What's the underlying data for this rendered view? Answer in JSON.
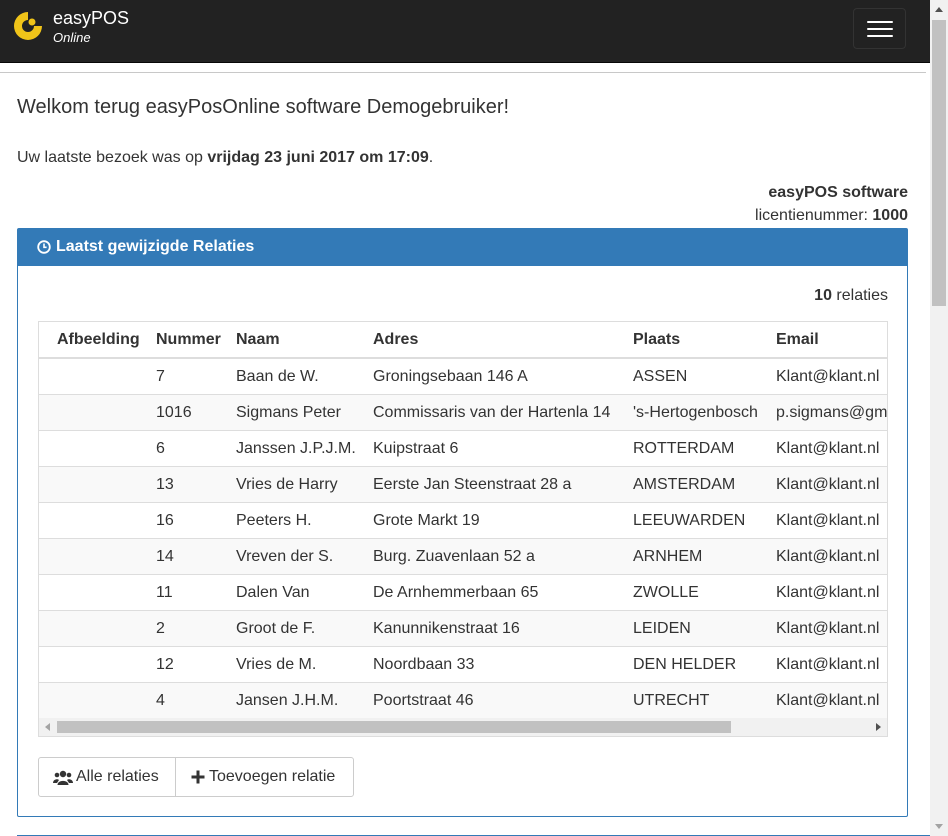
{
  "navbar": {
    "brand_name": "easyPOS",
    "brand_sub": "Online",
    "logo_color": "#f0c419"
  },
  "page": {
    "welcome": "Welkom terug easyPosOnline software Demogebruiker!",
    "last_visit_prefix": "Uw laatste bezoek was op ",
    "last_visit_date": "vrijdag 23 juni 2017 om 17:09",
    "last_visit_suffix": ".",
    "company": "easyPOS software",
    "license_label": "licentienummer: ",
    "license_number": "1000"
  },
  "panel": {
    "title": "Laatst gewijzigde Relaties",
    "count_value": "10",
    "count_label": " relaties",
    "accent": "#337ab7",
    "columns": [
      "Afbeelding",
      "Nummer",
      "Naam",
      "Adres",
      "Plaats",
      "Email"
    ],
    "rows": [
      {
        "img": "",
        "nummer": "7",
        "naam": "Baan de W.",
        "adres": "Groningsebaan 146 A",
        "plaats": "ASSEN",
        "email": "Klant@klant.nl"
      },
      {
        "img": "",
        "nummer": "1016",
        "naam": "Sigmans Peter",
        "adres": "Commissaris van der Hartenla 14",
        "plaats": "'s-Hertogenbosch",
        "email": "p.sigmans@gm"
      },
      {
        "img": "",
        "nummer": "6",
        "naam": "Janssen J.P.J.M.",
        "adres": "Kuipstraat 6",
        "plaats": "ROTTERDAM",
        "email": "Klant@klant.nl"
      },
      {
        "img": "",
        "nummer": "13",
        "naam": "Vries de Harry",
        "adres": "Eerste Jan Steenstraat 28 a",
        "plaats": "AMSTERDAM",
        "email": "Klant@klant.nl"
      },
      {
        "img": "",
        "nummer": "16",
        "naam": "Peeters H.",
        "adres": "Grote Markt 19",
        "plaats": "LEEUWARDEN",
        "email": "Klant@klant.nl"
      },
      {
        "img": "",
        "nummer": "14",
        "naam": "Vreven der S.",
        "adres": "Burg. Zuavenlaan 52 a",
        "plaats": "ARNHEM",
        "email": "Klant@klant.nl"
      },
      {
        "img": "",
        "nummer": "11",
        "naam": "Dalen Van",
        "adres": "De Arnhemmerbaan 65",
        "plaats": "ZWOLLE",
        "email": "Klant@klant.nl"
      },
      {
        "img": "",
        "nummer": "2",
        "naam": "Groot de F.",
        "adres": "Kanunnikenstraat 16",
        "plaats": "LEIDEN",
        "email": "Klant@klant.nl"
      },
      {
        "img": "",
        "nummer": "12",
        "naam": "Vries de M.",
        "adres": "Noordbaan 33",
        "plaats": "DEN HELDER",
        "email": "Klant@klant.nl"
      },
      {
        "img": "",
        "nummer": "4",
        "naam": "Jansen J.H.M.",
        "adres": "Poortstraat 46",
        "plaats": "UTRECHT",
        "email": "Klant@klant.nl"
      }
    ],
    "buttons": {
      "all_relations": "Alle relaties",
      "add_relation": "Toevoegen relatie"
    },
    "icons": {
      "heading": "clock-icon",
      "all_relations": "users-icon",
      "add_relation": "plus-icon"
    }
  }
}
